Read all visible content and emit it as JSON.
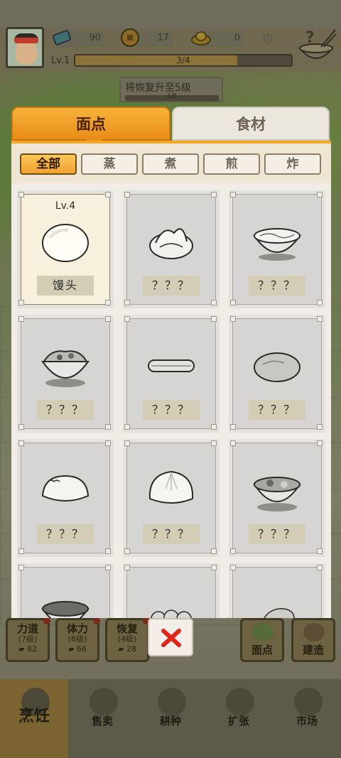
{
  "hud": {
    "resources": [
      {
        "icon": "ticket-icon",
        "value": "90"
      },
      {
        "icon": "coin-icon",
        "value": "17"
      },
      {
        "icon": "gold-ingot-icon",
        "value": "0"
      }
    ],
    "level": "Lv.1",
    "xp_text": "3/4",
    "xp_fraction": 0.75,
    "tip_text": "将恢复升至5级",
    "tip_progress": "4/5"
  },
  "tabs": [
    {
      "label": "面点",
      "active": true
    },
    {
      "label": "食材",
      "active": false
    }
  ],
  "filters": [
    {
      "label": "全部",
      "active": true
    },
    {
      "label": "蒸",
      "active": false
    },
    {
      "label": "煮",
      "active": false
    },
    {
      "label": "煎",
      "active": false
    },
    {
      "label": "炸",
      "active": false
    }
  ],
  "dishes": [
    {
      "name": "馒头",
      "level": "Lv.4",
      "unlocked": true,
      "icon": "mantou-icon"
    },
    {
      "name": "？？？",
      "level": "",
      "unlocked": false,
      "icon": "huajuan-icon"
    },
    {
      "name": "？？？",
      "level": "",
      "unlocked": false,
      "icon": "noodle-bowl-icon"
    },
    {
      "name": "？？？",
      "level": "",
      "unlocked": false,
      "icon": "rice-bowl-icon"
    },
    {
      "name": "？？？",
      "level": "",
      "unlocked": false,
      "icon": "youtiao-icon"
    },
    {
      "name": "？？？",
      "level": "",
      "unlocked": false,
      "icon": "pancake-icon"
    },
    {
      "name": "？？？",
      "level": "",
      "unlocked": false,
      "icon": "dumpling-icon"
    },
    {
      "name": "？？？",
      "level": "",
      "unlocked": false,
      "icon": "baozi-icon"
    },
    {
      "name": "？？？",
      "level": "",
      "unlocked": false,
      "icon": "noodle-soup-icon"
    },
    {
      "name": "",
      "level": "",
      "unlocked": false,
      "icon": "fish-bowl-icon"
    },
    {
      "name": "",
      "level": "",
      "unlocked": false,
      "icon": "shaomai-icon"
    },
    {
      "name": "",
      "level": "",
      "unlocked": false,
      "icon": "snack-plate-icon"
    }
  ],
  "stats": [
    {
      "name": "力道",
      "level": "(7级)",
      "cost": "82"
    },
    {
      "name": "体力",
      "level": "(6级)",
      "cost": "66"
    },
    {
      "name": "恢复",
      "level": "(4级)",
      "cost": "28"
    }
  ],
  "side_buttons": [
    {
      "label": "面点"
    },
    {
      "label": "建造"
    }
  ],
  "nav": [
    {
      "label": "烹饪",
      "active": true
    },
    {
      "label": "售卖",
      "active": false
    },
    {
      "label": "耕种",
      "active": false
    },
    {
      "label": "扩张",
      "active": false
    },
    {
      "label": "市场",
      "active": false
    }
  ],
  "colors": {
    "accent": "#f2a12f",
    "close": "#e0261b"
  }
}
